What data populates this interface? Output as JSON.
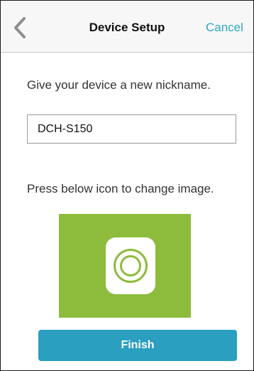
{
  "navbar": {
    "back_icon": "chevron-left-icon",
    "title": "Device Setup",
    "cancel_label": "Cancel"
  },
  "nickname": {
    "prompt": "Give your device a new nickname.",
    "value": "DCH-S150"
  },
  "image": {
    "prompt": "Press below icon to change image.",
    "icon": "device-ring-icon"
  },
  "finish_label": "Finish",
  "colors": {
    "accent": "#2a9fbf",
    "link": "#2ea7c4",
    "tile": "#8dbb3b"
  }
}
